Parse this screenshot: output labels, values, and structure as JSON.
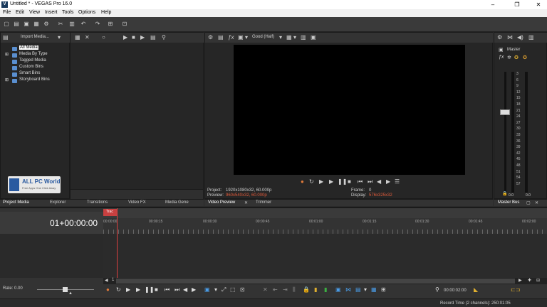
{
  "window": {
    "title": "Untitled * - VEGAS Pro 16.0",
    "app_icon_letter": "V",
    "minimize": "–",
    "maximize": "❐",
    "close": "✕"
  },
  "menu": [
    "File",
    "Edit",
    "View",
    "Insert",
    "Tools",
    "Options",
    "Help"
  ],
  "media_panel": {
    "import_label": "Import Media...",
    "tree": [
      "All Media",
      "Media By Type",
      "Tagged Media",
      "Custom Bins",
      "Smart Bins",
      "Storyboard Bins"
    ],
    "watermark": {
      "title": "ALL PC World",
      "subtitle": "Free Apps One Click Away"
    }
  },
  "left_tabs": [
    "Project Media",
    "Explorer",
    "Transitions",
    "Video FX",
    "Media Gene"
  ],
  "preview": {
    "quality": "Good (Half)",
    "project_label": "Project:",
    "project_value": "1920x1080x32, 60.000p",
    "preview_label": "Preview:",
    "preview_value": "960x540x32, 60.000p",
    "frame_label": "Frame:",
    "frame_value": "0",
    "display_label": "Display:",
    "display_value": "576x325x32",
    "tabs": [
      "Video Preview",
      "Trimmer"
    ]
  },
  "master": {
    "title": "Master",
    "scale": [
      "3",
      "6",
      "9",
      "12",
      "15",
      "18",
      "21",
      "24",
      "27",
      "30",
      "33",
      "36",
      "39",
      "42",
      "45",
      "48",
      "51",
      "54",
      "57"
    ],
    "bottom_left": "0.0",
    "bottom_right": "0.0",
    "tab": "Master Bus"
  },
  "timeline": {
    "timecode": "01+00:00:00",
    "marker_label": "Trac",
    "ruler": [
      "00:00:00",
      "00:00:15",
      "00:00:30",
      "00:00:45",
      "00:01:00",
      "00:01:15",
      "00:01:30",
      "00:01:45",
      "00:02:00"
    ],
    "rate_label": "Rate: 0.00",
    "scroll_pos": "1",
    "cursor_time": "00:00:02:00",
    "record_time": "Record Time (2 channels): 250:01:05"
  },
  "colors": {
    "accent": "#4a9de8",
    "marker": "#d94040",
    "selected": "#4a6fa5"
  }
}
